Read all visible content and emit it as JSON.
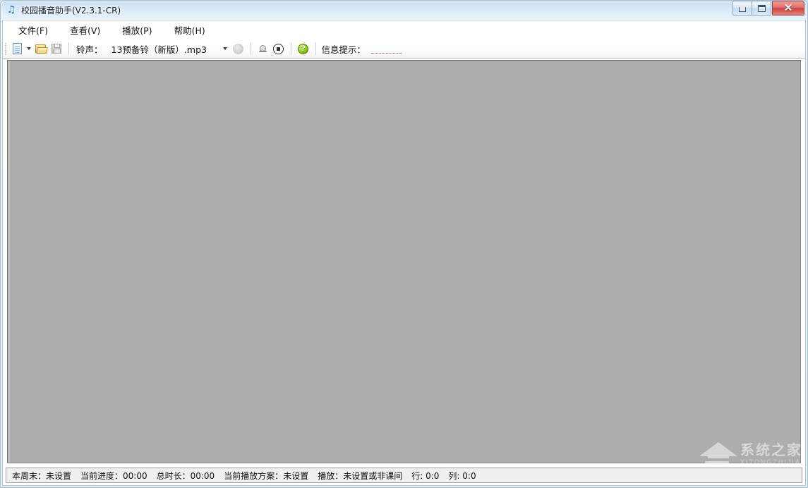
{
  "window": {
    "title": "校园播音助手(V2.3.1-CR)",
    "icon": "music-note-icon",
    "controls": {
      "minimize_label": "",
      "maximize_label": "",
      "close_label": "✕"
    }
  },
  "menu": {
    "items": [
      {
        "label": "文件(F)",
        "name": "menu-file"
      },
      {
        "label": "查看(V)",
        "name": "menu-view"
      },
      {
        "label": "播放(P)",
        "name": "menu-play"
      },
      {
        "label": "帮助(H)",
        "name": "menu-help"
      }
    ]
  },
  "toolbar": {
    "new_icon": "new-document-icon",
    "new_dropdown_icon": "chevron-down-icon",
    "open_icon": "open-folder-icon",
    "save_icon": "save-disk-icon",
    "ring_label": "铃声：",
    "ring_value": "13预备铃（新版）.mp3",
    "ring_dropdown_icon": "chevron-down-icon",
    "play_icon": "play-circle-icon",
    "bell_icon": "bell-icon",
    "stop_icon": "stop-circle-icon",
    "help_icon": "help-question-icon",
    "help_glyph": "?",
    "info_label": "信息提示：",
    "info_value": ""
  },
  "status": {
    "weekend_label": "本周末：未设置",
    "progress_label": "当前进度：00:00",
    "duration_label": "总时长：00:00",
    "scheme_label": "当前播放方案：未设置",
    "playing_label": "播放：未设置或非课间",
    "row_label": "行: 0:0",
    "col_label": "列: 0:0"
  },
  "watermark": {
    "cn": "系统之家",
    "en": "XITONGZHIJIA"
  },
  "colors": {
    "title_bar": "#cfe3f7",
    "close_button": "#c9453c",
    "editor_background": "#adadad",
    "status_background": "#f0f0f0",
    "help_icon": "#97cc17",
    "folder_icon": "#f0c055",
    "info_underline": "#c04b4b"
  }
}
